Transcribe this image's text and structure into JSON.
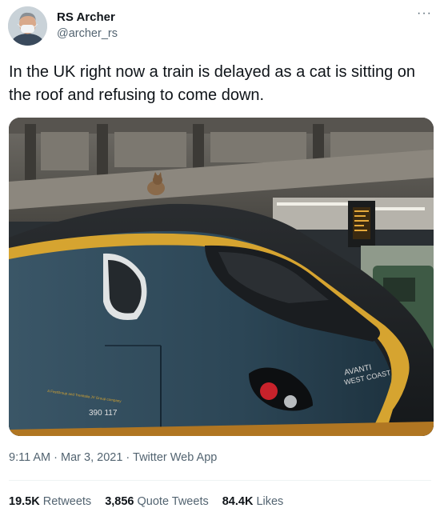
{
  "author": {
    "name": "RS Archer",
    "handle": "@archer_rs",
    "more_glyph": "···"
  },
  "tweet": {
    "text": "In the UK right now a train is delayed as a cat is sitting on the roof and refusing to come down."
  },
  "media": {
    "train_livery_text": "AVANTI",
    "train_livery_text2": "WEST COAST",
    "train_number": "390 117",
    "train_side_text": "A FirstGroup and Trenitalia JV Group company"
  },
  "meta": {
    "time": "9:11 AM",
    "sep1": " · ",
    "date": "Mar 3, 2021",
    "sep2": " · ",
    "app": "Twitter Web App"
  },
  "stats": {
    "retweets_count": "19.5K",
    "retweets_label": "Retweets",
    "quotes_count": "3,856",
    "quotes_label": "Quote Tweets",
    "likes_count": "84.4K",
    "likes_label": "Likes"
  },
  "colors": {
    "handle_gray": "#536471",
    "text": "#0f1419",
    "divider": "#eff3f4"
  }
}
